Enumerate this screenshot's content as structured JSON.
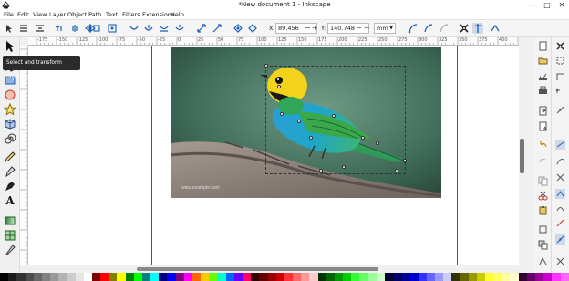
{
  "window": {
    "title": "*New document 1 - Inkscape",
    "buttons": {
      "minimize": "—",
      "maximize": "□",
      "close": "✕"
    }
  },
  "menu": [
    "File",
    "Edit",
    "View",
    "Layer",
    "Object",
    "Path",
    "Text",
    "Filters",
    "Extensions",
    "Help"
  ],
  "toolbar": {
    "x_label": "X:",
    "x_value": "89.456",
    "y_label": "Y:",
    "y_value": "140.748",
    "spin_minus": "−",
    "spin_plus": "+",
    "unit": "mm",
    "icons": [
      "select-all-icon",
      "select-all-layers-icon",
      "deselect-icon",
      "rotate-ccw-icon",
      "rotate-cw-icon",
      "flip-horizontal-icon",
      "flip-vertical-icon",
      "raise-to-top-icon",
      "raise-icon",
      "lower-icon",
      "lower-to-bottom-icon",
      "scale-stroke-icon",
      "scale-corners-icon",
      "transform-gradients-icon",
      "transform-patterns-icon"
    ]
  },
  "ruler": {
    "h_labels": [
      "-175",
      "-150",
      "-125",
      "-100",
      "-75",
      "-50",
      "-25",
      "0",
      "25",
      "50",
      "75",
      "100",
      "125",
      "150",
      "175",
      "200",
      "225",
      "250",
      "275",
      "300",
      "325",
      "350",
      "375",
      "400"
    ]
  },
  "tools": [
    "selector-icon",
    "node-icon",
    "rectangle-icon",
    "ellipse-icon",
    "star-icon",
    "box3d-icon",
    "spiral-icon",
    "pencil-icon",
    "pen-icon",
    "calligraphy-icon",
    "text-icon",
    "gradient-icon",
    "mesh-icon",
    "dropper-icon"
  ],
  "tooltip": "Select and transform objects (S)",
  "image": {
    "subject": "bird-photo",
    "watermark": "www.example.com"
  },
  "colors": {
    "accent": "#2b2b2b",
    "palette": [
      "#000000",
      "#1a1a1a",
      "#333333",
      "#4d4d4d",
      "#666666",
      "#808080",
      "#999999",
      "#b3b3b3",
      "#cccccc",
      "#e6e6e6",
      "#ffffff",
      "#800000",
      "#ff0000",
      "#808000",
      "#ffff00",
      "#008000",
      "#00ff00",
      "#008080",
      "#00ffff",
      "#000080",
      "#0000ff",
      "#800080",
      "#ff00ff",
      "#ff6600",
      "#ffcc00",
      "#66ff00",
      "#00ffcc",
      "#0066ff",
      "#6600ff",
      "#ff0066",
      "#330000",
      "#660000",
      "#990000",
      "#cc0000",
      "#ff3333",
      "#ff6666",
      "#ff9999",
      "#ffcccc",
      "#003300",
      "#006600",
      "#009900",
      "#00cc00",
      "#33ff33",
      "#66ff66",
      "#99ff99",
      "#ccffcc",
      "#000033",
      "#000066",
      "#000099",
      "#0000cc",
      "#3333ff",
      "#6666ff",
      "#9999ff",
      "#ccccff",
      "#333300",
      "#666600",
      "#999900",
      "#cccc00",
      "#ffff33",
      "#ffff66",
      "#ffff99",
      "#ffffcc",
      "#330033",
      "#660066",
      "#990099",
      "#cc00cc",
      "#ff33ff",
      "#ff66ff"
    ]
  }
}
